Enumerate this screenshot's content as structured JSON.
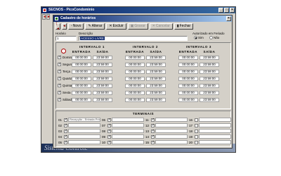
{
  "app": {
    "title": "SECNOS - PicoCondominio",
    "min": "_",
    "max": "□",
    "close": "×",
    "watermark": "Sistema Controle"
  },
  "dialog": {
    "title": "Cadastro de horários",
    "close": "×",
    "toolbar": [
      {
        "label": "Novo",
        "glyph": "▫",
        "disabled": false
      },
      {
        "label": "Alterar",
        "glyph": "✎",
        "disabled": false
      },
      {
        "label": "Excluir",
        "glyph": "✕",
        "disabled": false
      },
      {
        "label": "Gravar",
        "glyph": "▣",
        "disabled": true
      },
      {
        "label": "Cancelar",
        "glyph": "✕",
        "disabled": true
      },
      {
        "label": "Fechar",
        "glyph": "▮",
        "disabled": false
      }
    ],
    "nav": [
      "|◄",
      "◄",
      "►",
      "►|"
    ],
    "fields": {
      "horario_label": "Horário",
      "horario_value": "1",
      "descricao_label": "Descrição",
      "descricao_value": "ACESSO LIVRE",
      "feriado_label": "Autorizado em Feriado",
      "opt_sim": "Sim",
      "opt_nao": "Não",
      "feriado_selected": "Sim"
    },
    "intervals": {
      "headers": [
        "INTERVALO 1",
        "INTERVALO 2",
        "INTERVALO 3"
      ],
      "sub": [
        "ENTRADA",
        "SAÍDA"
      ],
      "days": [
        {
          "name": "Domingo",
          "checked": true,
          "times": [
            "00:00:00",
            "23:59:00",
            "00:00:00",
            "23:59:00",
            "00:00:00",
            "23:59:00"
          ]
        },
        {
          "name": "Segunda",
          "checked": true,
          "times": [
            "00:00:00",
            "23:59:00",
            "00:00:00",
            "23:59:00",
            "00:00:00",
            "23:59:00"
          ]
        },
        {
          "name": "Terça",
          "checked": true,
          "times": [
            "00:00:00",
            "23:59:00",
            "00:00:00",
            "23:59:00",
            "00:00:00",
            "23:59:00"
          ]
        },
        {
          "name": "Quarta",
          "checked": true,
          "times": [
            "00:00:00",
            "23:59:00",
            "00:00:00",
            "23:59:00",
            "00:00:00",
            "23:59:00"
          ]
        },
        {
          "name": "Quinta",
          "checked": true,
          "times": [
            "00:00:00",
            "23:59:00",
            "00:00:00",
            "23:59:00",
            "00:00:00",
            "23:59:00"
          ]
        },
        {
          "name": "Sexta",
          "checked": true,
          "times": [
            "00:00:00",
            "23:59:00",
            "00:00:00",
            "23:59:00",
            "00:00:00",
            "23:59:00"
          ]
        },
        {
          "name": "Sábado",
          "checked": true,
          "times": [
            "00:00:00",
            "23:59:00",
            "00:00:00",
            "23:59:00",
            "00:00:00",
            "23:59:00"
          ]
        }
      ]
    },
    "terminais": {
      "title": "TERMINAIS",
      "items": [
        {
          "num": "01",
          "checked": true,
          "name": "Recepção - Entrada Princ"
        },
        {
          "num": "02",
          "checked": true,
          "name": ""
        },
        {
          "num": "03",
          "checked": true,
          "name": ""
        },
        {
          "num": "04",
          "checked": true,
          "name": ""
        },
        {
          "num": "05",
          "checked": true,
          "name": ""
        },
        {
          "num": "06",
          "checked": true,
          "name": ""
        },
        {
          "num": "07",
          "checked": true,
          "name": ""
        },
        {
          "num": "08",
          "checked": true,
          "name": ""
        },
        {
          "num": "09",
          "checked": true,
          "name": ""
        },
        {
          "num": "10",
          "checked": true,
          "name": ""
        },
        {
          "num": "11",
          "checked": true,
          "name": ""
        },
        {
          "num": "12",
          "checked": true,
          "name": ""
        },
        {
          "num": "13",
          "checked": true,
          "name": ""
        },
        {
          "num": "14",
          "checked": true,
          "name": ""
        },
        {
          "num": "15",
          "checked": true,
          "name": ""
        },
        {
          "num": "16",
          "checked": false,
          "name": ""
        },
        {
          "num": "17",
          "checked": false,
          "name": ""
        },
        {
          "num": "18",
          "checked": false,
          "name": ""
        },
        {
          "num": "19",
          "checked": false,
          "name": ""
        },
        {
          "num": "20",
          "checked": false,
          "name": ""
        }
      ]
    }
  }
}
